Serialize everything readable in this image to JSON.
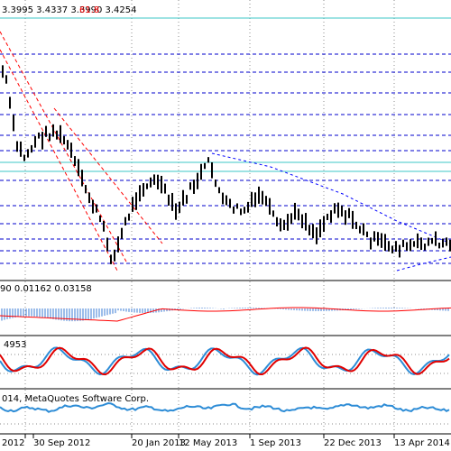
{
  "colors": {
    "background": "#ffffff",
    "grid": "#8c8c8c",
    "hline": "#0000cc",
    "hline_cyan": "#3ec7c7",
    "bars": "#000000",
    "channel": "#ff0000",
    "trend": "#0000ff",
    "hist": "#3a7bd5",
    "signal": "#ff0000",
    "stoch_main": "#2d8cd6",
    "stoch_signal": "#e00000",
    "ind3": "#2d8cd6",
    "fibo_text": "#ff0000",
    "text": "#000000"
  },
  "main": {
    "header_values": "3.3995  3.4337  3.3990  3.4254",
    "fibo_label": "61.8"
  },
  "indicators": {
    "macd_values": "90  0.01162  0.03158",
    "stoch_values": "4953"
  },
  "footer": {
    "copyright": "014, MetaQuotes Software Corp."
  },
  "x_axis": {
    "labels": [
      "2012",
      "30 Sep 2012",
      "20 Jan 2013",
      "12 May 2013",
      "1 Sep 2013",
      "22 Dec 2013",
      "13 Apr 2014"
    ]
  }
}
